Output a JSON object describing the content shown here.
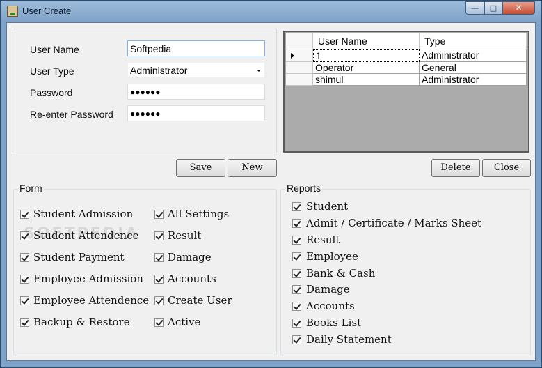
{
  "window": {
    "title": "User Create",
    "min_glyph": "—",
    "max_glyph": "□",
    "close_glyph": "✕"
  },
  "user_form": {
    "user_name_label": "User Name",
    "user_name_value": "Softpedia",
    "user_type_label": "User Type",
    "user_type_value": "Administrator",
    "password_label": "Password",
    "password_value": "●●●●●●",
    "reenter_label": "Re-enter Password",
    "reenter_value": "●●●●●●"
  },
  "grid": {
    "columns": [
      "User Name",
      "Type"
    ],
    "rows": [
      {
        "user_name": "1",
        "type": "Administrator"
      },
      {
        "user_name": "Operator",
        "type": "General"
      },
      {
        "user_name": "shimul",
        "type": "Administrator"
      }
    ]
  },
  "buttons": {
    "save": "Save",
    "new": "New",
    "delete": "Delete",
    "close": "Close"
  },
  "form_group": {
    "title": "Form",
    "left_items": [
      "Student Admission",
      "Student Attendence",
      "Student Payment",
      "Employee Admission",
      "Employee Attendence",
      "Backup & Restore"
    ],
    "right_items": [
      "All Settings",
      "Result",
      "Damage",
      "Accounts",
      "Create User",
      "Active"
    ]
  },
  "reports_group": {
    "title": "Reports",
    "items": [
      "Student",
      "Admit / Certificate / Marks Sheet",
      "Result",
      "Employee",
      "Bank & Cash",
      "Damage",
      "Accounts",
      "Books List",
      "Daily Statement"
    ]
  },
  "watermark": "SOFTPEDIA",
  "icons": [
    "app-icon",
    "minimize-icon",
    "maximize-icon",
    "close-icon",
    "dropdown-arrow-icon",
    "row-pointer-icon",
    "check-icon"
  ]
}
